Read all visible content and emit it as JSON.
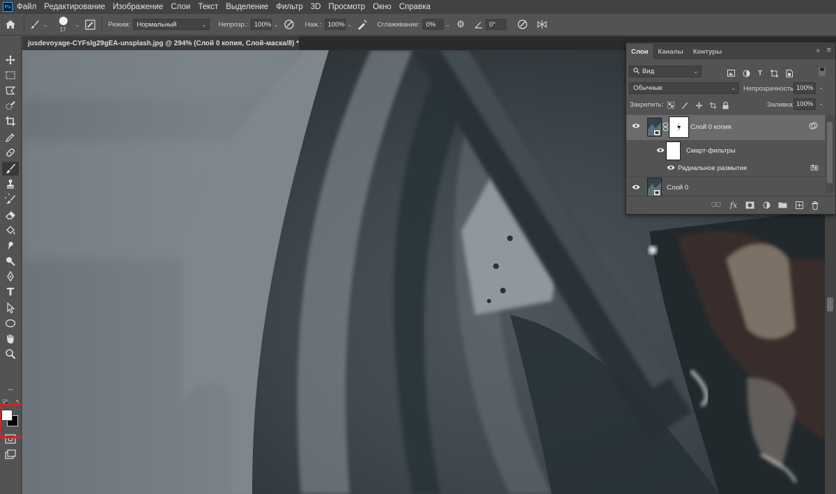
{
  "menu": {
    "app_logo": "Ps",
    "items": [
      "Файл",
      "Редактирование",
      "Изображение",
      "Слои",
      "Текст",
      "Выделение",
      "Фильтр",
      "3D",
      "Просмотр",
      "Окно",
      "Справка"
    ]
  },
  "options_bar": {
    "brush_size": "17",
    "mode_label": "Режим:",
    "mode_value": "Нормальный",
    "opacity_label": "Непрозр.:",
    "opacity_value": "100%",
    "flow_label": "Наж.:",
    "flow_value": "100%",
    "smoothing_label": "Сглаживание:",
    "smoothing_value": "0%",
    "angle_value": "0°",
    "icons": [
      "home-icon",
      "brush-icon",
      "brush-settings-icon",
      "pressure-opacity-icon",
      "airbrush-icon",
      "smoothing-gear-icon",
      "angle-icon",
      "pressure-size-icon",
      "symmetry-icon"
    ]
  },
  "document": {
    "tab_title": "jusdevoyage-CYFslg29gEA-unsplash.jpg @ 294% (Слой 0 копия, Слой-маска/8) *",
    "close": "×"
  },
  "toolbar": {
    "tools": [
      "move-tool-icon",
      "marquee-tool-icon",
      "lasso-tool-icon",
      "quick-select-tool-icon",
      "crop-tool-icon",
      "eyedropper-tool-icon",
      "healing-brush-tool-icon",
      "brush-tool-icon",
      "stamp-tool-icon",
      "history-brush-tool-icon",
      "eraser-tool-icon",
      "paint-bucket-tool-icon",
      "smudge-tool-icon",
      "dodge-tool-icon",
      "pen-tool-icon",
      "type-tool-icon",
      "path-select-tool-icon",
      "ellipse-tool-icon",
      "hand-tool-icon",
      "zoom-tool-icon",
      "more-tools-icon"
    ],
    "type_tool_glyph": "T",
    "more_glyph": "···",
    "foreground_color": "#ffffff",
    "background_color": "#000000"
  },
  "layers_panel": {
    "tabs": [
      "Слои",
      "Каналы",
      "Контуры"
    ],
    "active_tab": "Слои",
    "collapse": "»",
    "filter_kind": "Вид",
    "blend_mode": "Обычные",
    "opacity_label": "Непрозрачность:",
    "opacity_value": "100%",
    "lock_label": "Закрепить:",
    "fill_label": "Заливка:",
    "fill_value": "100%",
    "layers": [
      {
        "name": "Слой 0 копия",
        "selected": true,
        "has_mask": true,
        "smart": true
      },
      {
        "name": "Смарт-фильтры",
        "type": "smart-filters"
      },
      {
        "name": "Радиальное размытие",
        "type": "filter"
      },
      {
        "name": "Слой 0",
        "selected": false,
        "smart": true
      }
    ],
    "footer_icons": [
      "link-layers-icon",
      "fx-icon",
      "add-mask-icon",
      "adjustment-layer-icon",
      "new-group-icon",
      "new-layer-icon",
      "delete-layer-icon"
    ],
    "fx_glyph": "fx"
  },
  "colors": {
    "highlight_box": "#e01e1e",
    "accent": "#31a8ff"
  }
}
